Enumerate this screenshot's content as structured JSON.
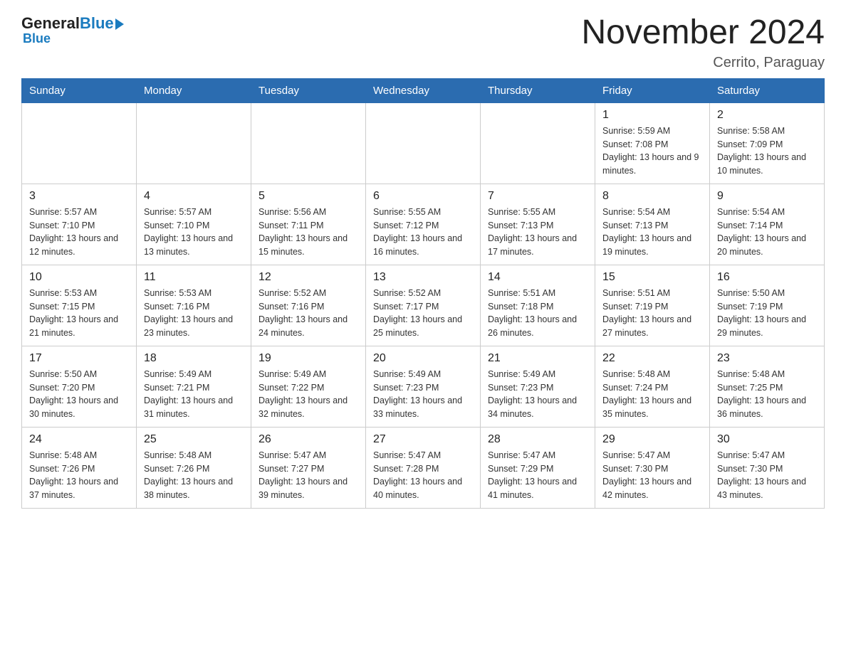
{
  "header": {
    "logo_general": "General",
    "logo_blue": "Blue",
    "month_title": "November 2024",
    "location": "Cerrito, Paraguay"
  },
  "days_of_week": [
    "Sunday",
    "Monday",
    "Tuesday",
    "Wednesday",
    "Thursday",
    "Friday",
    "Saturday"
  ],
  "weeks": [
    [
      {
        "day": "",
        "info": ""
      },
      {
        "day": "",
        "info": ""
      },
      {
        "day": "",
        "info": ""
      },
      {
        "day": "",
        "info": ""
      },
      {
        "day": "",
        "info": ""
      },
      {
        "day": "1",
        "info": "Sunrise: 5:59 AM\nSunset: 7:08 PM\nDaylight: 13 hours and 9 minutes."
      },
      {
        "day": "2",
        "info": "Sunrise: 5:58 AM\nSunset: 7:09 PM\nDaylight: 13 hours and 10 minutes."
      }
    ],
    [
      {
        "day": "3",
        "info": "Sunrise: 5:57 AM\nSunset: 7:10 PM\nDaylight: 13 hours and 12 minutes."
      },
      {
        "day": "4",
        "info": "Sunrise: 5:57 AM\nSunset: 7:10 PM\nDaylight: 13 hours and 13 minutes."
      },
      {
        "day": "5",
        "info": "Sunrise: 5:56 AM\nSunset: 7:11 PM\nDaylight: 13 hours and 15 minutes."
      },
      {
        "day": "6",
        "info": "Sunrise: 5:55 AM\nSunset: 7:12 PM\nDaylight: 13 hours and 16 minutes."
      },
      {
        "day": "7",
        "info": "Sunrise: 5:55 AM\nSunset: 7:13 PM\nDaylight: 13 hours and 17 minutes."
      },
      {
        "day": "8",
        "info": "Sunrise: 5:54 AM\nSunset: 7:13 PM\nDaylight: 13 hours and 19 minutes."
      },
      {
        "day": "9",
        "info": "Sunrise: 5:54 AM\nSunset: 7:14 PM\nDaylight: 13 hours and 20 minutes."
      }
    ],
    [
      {
        "day": "10",
        "info": "Sunrise: 5:53 AM\nSunset: 7:15 PM\nDaylight: 13 hours and 21 minutes."
      },
      {
        "day": "11",
        "info": "Sunrise: 5:53 AM\nSunset: 7:16 PM\nDaylight: 13 hours and 23 minutes."
      },
      {
        "day": "12",
        "info": "Sunrise: 5:52 AM\nSunset: 7:16 PM\nDaylight: 13 hours and 24 minutes."
      },
      {
        "day": "13",
        "info": "Sunrise: 5:52 AM\nSunset: 7:17 PM\nDaylight: 13 hours and 25 minutes."
      },
      {
        "day": "14",
        "info": "Sunrise: 5:51 AM\nSunset: 7:18 PM\nDaylight: 13 hours and 26 minutes."
      },
      {
        "day": "15",
        "info": "Sunrise: 5:51 AM\nSunset: 7:19 PM\nDaylight: 13 hours and 27 minutes."
      },
      {
        "day": "16",
        "info": "Sunrise: 5:50 AM\nSunset: 7:19 PM\nDaylight: 13 hours and 29 minutes."
      }
    ],
    [
      {
        "day": "17",
        "info": "Sunrise: 5:50 AM\nSunset: 7:20 PM\nDaylight: 13 hours and 30 minutes."
      },
      {
        "day": "18",
        "info": "Sunrise: 5:49 AM\nSunset: 7:21 PM\nDaylight: 13 hours and 31 minutes."
      },
      {
        "day": "19",
        "info": "Sunrise: 5:49 AM\nSunset: 7:22 PM\nDaylight: 13 hours and 32 minutes."
      },
      {
        "day": "20",
        "info": "Sunrise: 5:49 AM\nSunset: 7:23 PM\nDaylight: 13 hours and 33 minutes."
      },
      {
        "day": "21",
        "info": "Sunrise: 5:49 AM\nSunset: 7:23 PM\nDaylight: 13 hours and 34 minutes."
      },
      {
        "day": "22",
        "info": "Sunrise: 5:48 AM\nSunset: 7:24 PM\nDaylight: 13 hours and 35 minutes."
      },
      {
        "day": "23",
        "info": "Sunrise: 5:48 AM\nSunset: 7:25 PM\nDaylight: 13 hours and 36 minutes."
      }
    ],
    [
      {
        "day": "24",
        "info": "Sunrise: 5:48 AM\nSunset: 7:26 PM\nDaylight: 13 hours and 37 minutes."
      },
      {
        "day": "25",
        "info": "Sunrise: 5:48 AM\nSunset: 7:26 PM\nDaylight: 13 hours and 38 minutes."
      },
      {
        "day": "26",
        "info": "Sunrise: 5:47 AM\nSunset: 7:27 PM\nDaylight: 13 hours and 39 minutes."
      },
      {
        "day": "27",
        "info": "Sunrise: 5:47 AM\nSunset: 7:28 PM\nDaylight: 13 hours and 40 minutes."
      },
      {
        "day": "28",
        "info": "Sunrise: 5:47 AM\nSunset: 7:29 PM\nDaylight: 13 hours and 41 minutes."
      },
      {
        "day": "29",
        "info": "Sunrise: 5:47 AM\nSunset: 7:30 PM\nDaylight: 13 hours and 42 minutes."
      },
      {
        "day": "30",
        "info": "Sunrise: 5:47 AM\nSunset: 7:30 PM\nDaylight: 13 hours and 43 minutes."
      }
    ]
  ]
}
